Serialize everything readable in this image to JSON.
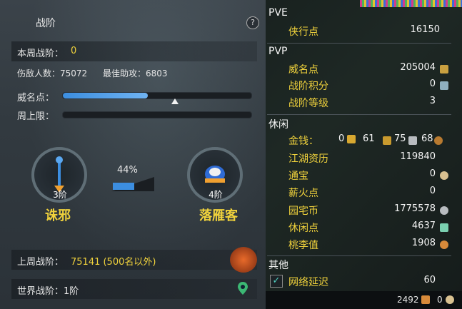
{
  "left": {
    "title": "战阶",
    "help": "?",
    "weekly_label": "本周战阶：",
    "weekly_value": "0",
    "damage_label": "伤敌人数：75072",
    "assist_label": "最佳助攻：6803",
    "prestige_label": "威名点：",
    "weekly_cap_label": "周上限：",
    "prestige_progress": 0.45,
    "rank_left": {
      "level": "3阶",
      "name": "诛邪"
    },
    "rank_right": {
      "level": "4阶",
      "name": "落雁客"
    },
    "progress_pct": "44%",
    "last_week_label": "上周战阶：",
    "last_week_value": "75141 (500名以外)",
    "world_label": "世界战阶：1阶"
  },
  "right": {
    "pve": {
      "title": "PVE",
      "items": [
        {
          "label": "侠行点",
          "value": "16150"
        }
      ]
    },
    "pvp": {
      "title": "PVP",
      "items": [
        {
          "label": "威名点",
          "value": "205004"
        },
        {
          "label": "战阶积分",
          "value": "0"
        },
        {
          "label": "战阶等级",
          "value": "3"
        }
      ]
    },
    "leisure": {
      "title": "休闲",
      "money_label": "金钱：",
      "money": [
        "0",
        "61",
        "75",
        "68"
      ],
      "items": [
        {
          "label": "江湖资历",
          "value": "119840"
        },
        {
          "label": "通宝",
          "value": "0"
        },
        {
          "label": "薪火点",
          "value": "0"
        },
        {
          "label": "园宅币",
          "value": "1775578"
        },
        {
          "label": "休闲点",
          "value": "4637"
        },
        {
          "label": "桃李值",
          "value": "1908"
        }
      ]
    },
    "other": {
      "title": "其他",
      "items": [
        {
          "label": "网络延迟",
          "value": "60"
        }
      ]
    },
    "bottom": {
      "left_value": "2492",
      "right_value": "0"
    }
  }
}
